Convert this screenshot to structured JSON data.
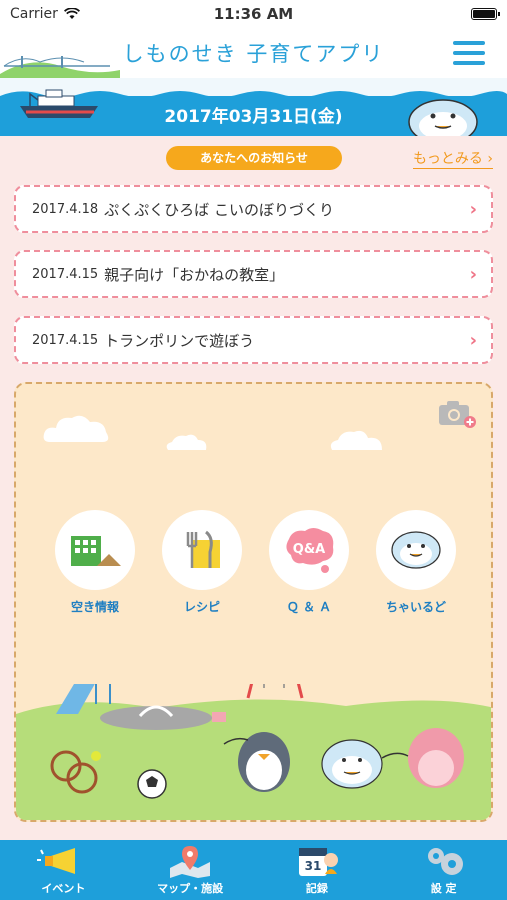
{
  "status_bar": {
    "carrier": "Carrier",
    "time": "11:36 AM"
  },
  "header": {
    "title": "しものせき 子育てアプリ"
  },
  "date_band": {
    "date": "2017年03月31日(金)"
  },
  "notices": {
    "heading": "あなたへのお知らせ",
    "more_label": "もっとみる",
    "items": [
      {
        "date": "2017.4.18",
        "title": "ぷくぷくひろば こいのぼりづくり"
      },
      {
        "date": "2017.4.15",
        "title": "親子向け「おかねの教室」"
      },
      {
        "date": "2017.4.15",
        "title": "トランポリンで遊ぼう"
      }
    ]
  },
  "menu_circles": [
    {
      "label": "空き情報",
      "icon": "building-icon"
    },
    {
      "label": "レシピ",
      "icon": "cutlery-icon"
    },
    {
      "label": "Ｑ ＆ Ａ",
      "icon": "qa-bubble-icon"
    },
    {
      "label": "ちゃいるど",
      "icon": "mascot-icon"
    }
  ],
  "tabs": [
    {
      "label": "イベント",
      "icon": "megaphone-icon"
    },
    {
      "label": "マップ・施設",
      "icon": "map-pin-icon"
    },
    {
      "label": "記録",
      "icon": "calendar-icon",
      "badge": "31"
    },
    {
      "label": "設 定",
      "icon": "gear-icon"
    }
  ],
  "colors": {
    "accent_blue": "#1e9fda",
    "accent_orange": "#f6a81c",
    "notice_border": "#ef8e9c"
  }
}
